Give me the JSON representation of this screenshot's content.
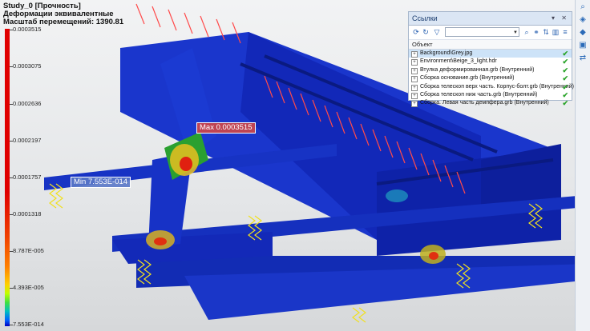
{
  "info": {
    "line1": "Study_0 [Прочность]",
    "line2": "Деформации эквивалентные",
    "line3": "Масштаб перемещений: 1390.81"
  },
  "legend": {
    "ticks": [
      "0.0003515",
      "0.0003075",
      "0.0002636",
      "0.0002197",
      "0.0001757",
      "0.0001318",
      "8.787E-005",
      "4.393E-005",
      "7.553E-014"
    ]
  },
  "markers": {
    "max": "Max 0.0003515",
    "min": "Min 7.553E-014"
  },
  "panel": {
    "title": "Ссылки",
    "title_buttons": "▾ ✕",
    "column": "Объект",
    "rows": [
      "Background\\Grey.jpg",
      "Environment\\Beige_3_light.hdr",
      "Втулка деформированная.grb (Внутренний)",
      "Сборка основание.grb (Внутренний)",
      "Сборка телескоп верх часть. Корпус-болт.grb (Внутренний)",
      "Сборка телескоп ниж часть.grb (Внутренний)",
      "Сборка. Левая часть демпфера.grb (Внутренний)"
    ]
  },
  "colors": {
    "blue_body": "#1530c8",
    "dark_blue": "#0a1a90",
    "hot": "#e02010",
    "load": "#ff4040",
    "support": "#f0e020"
  }
}
